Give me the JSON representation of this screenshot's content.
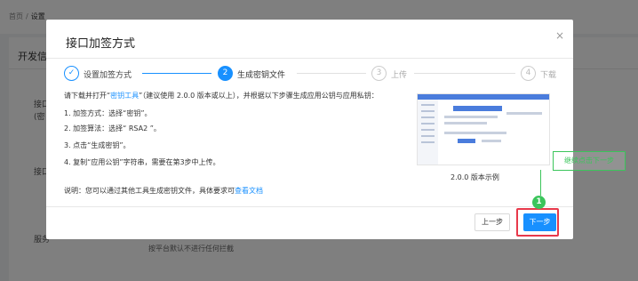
{
  "breadcrumb": {
    "home": "首页",
    "separator": "/",
    "current": "设置"
  },
  "background": {
    "section_title": "开发信",
    "labels": [
      "接口",
      "(密",
      "接口",
      "服务"
    ],
    "note": "按平台默认不进行任何拦截"
  },
  "modal": {
    "title": "接口加签方式",
    "close_icon": "×",
    "steps": [
      {
        "icon": "✓",
        "label": "设置加签方式",
        "state": "done"
      },
      {
        "icon": "2",
        "label": "生成密钥文件",
        "state": "active"
      },
      {
        "icon": "3",
        "label": "上传",
        "state": "wait"
      },
      {
        "icon": "4",
        "label": "下载",
        "state": "wait"
      }
    ],
    "intro": {
      "before_link": "请下载并打开“",
      "link": "密钥工具",
      "after_link": "”（建议使用 2.0.0 版本或以上），并根据以下步骤生成应用公钥与应用私钥："
    },
    "instructions": [
      "1. 加签方式：选择“密钥”。",
      "2. 加签算法：选择“ RSA2 ”。",
      "3. 点击“生成密钥”。",
      "4. 复制“应用公钥”字符串，需要在第3步中上传。"
    ],
    "example_caption": "2.0.0 版本示例",
    "note": {
      "text": "说明：您可以通过其他工具生成密钥文件，具体要求可",
      "link": "查看文档"
    },
    "buttons": {
      "prev": "上一步",
      "next": "下一步"
    }
  },
  "annotation": {
    "number": "1",
    "tooltip": "继续点击下一步"
  },
  "colors": {
    "primary": "#1890ff",
    "annotation_green": "#3bc55b",
    "annotation_red": "#e8394b"
  }
}
